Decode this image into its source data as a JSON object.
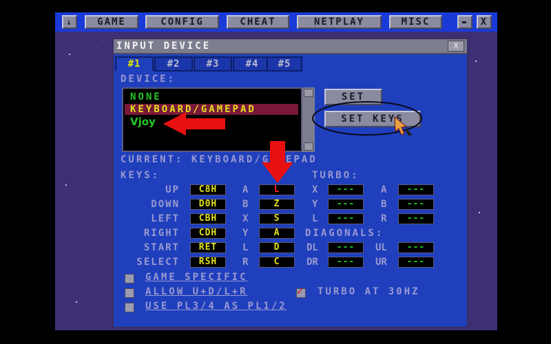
{
  "menu": {
    "down_icon": "down-arrow-icon",
    "items": [
      "GAME",
      "CONFIG",
      "CHEAT",
      "NETPLAY",
      "MISC"
    ],
    "minimize_icon": "minimize-icon",
    "close_icon": "close-icon",
    "close_label": "X"
  },
  "window": {
    "title": "INPUT DEVICE",
    "close_label": "X",
    "tabs": [
      "#1",
      "#2",
      "#3",
      "#4",
      "#5"
    ]
  },
  "device": {
    "label": "DEVICE:",
    "list": [
      "NONE",
      "KEYBOARD/GAMEPAD",
      "Vjoy"
    ],
    "set_button": "SET",
    "set_keys_button": "SET KEYS",
    "current": "CURRENT: KEYBOARD/GAMEPAD"
  },
  "keys": {
    "label": "KEYS:",
    "rows": [
      {
        "name": "UP",
        "code": "C8H",
        "btn": "A",
        "key": "L"
      },
      {
        "name": "DOWN",
        "code": "D0H",
        "btn": "B",
        "key": "Z"
      },
      {
        "name": "LEFT",
        "code": "CBH",
        "btn": "X",
        "key": "S"
      },
      {
        "name": "RIGHT",
        "code": "CDH",
        "btn": "Y",
        "key": "A"
      },
      {
        "name": "START",
        "code": "RET",
        "btn": "L",
        "key": "D"
      },
      {
        "name": "SELECT",
        "code": "RSH",
        "btn": "R",
        "key": "C"
      }
    ]
  },
  "turbo": {
    "label": "TURBO:",
    "rows": [
      {
        "a": "X",
        "av": "---",
        "b": "A",
        "bv": "---"
      },
      {
        "a": "Y",
        "av": "---",
        "b": "B",
        "bv": "---"
      },
      {
        "a": "L",
        "av": "---",
        "b": "R",
        "bv": "---"
      }
    ]
  },
  "diagonals": {
    "label": "DIAGONALS:",
    "rows": [
      {
        "a": "DL",
        "av": "---",
        "b": "UL",
        "bv": "---"
      },
      {
        "a": "DR",
        "av": "---",
        "b": "UR",
        "bv": "---"
      }
    ]
  },
  "options": {
    "game_specific": "GAME SPECIFIC",
    "allow": "ALLOW U+D/L+R",
    "turbo_30": "TURBO AT 30HZ",
    "use_pl34": "USE PL3/4 AS PL1/2",
    "turbo_checked": true
  },
  "colors": {
    "menubar": "#1a3ad8",
    "window": "#1f3fbd",
    "key_green": "#22c922",
    "highlight_yellow": "#e0e020",
    "arrow_red": "#e81010"
  }
}
